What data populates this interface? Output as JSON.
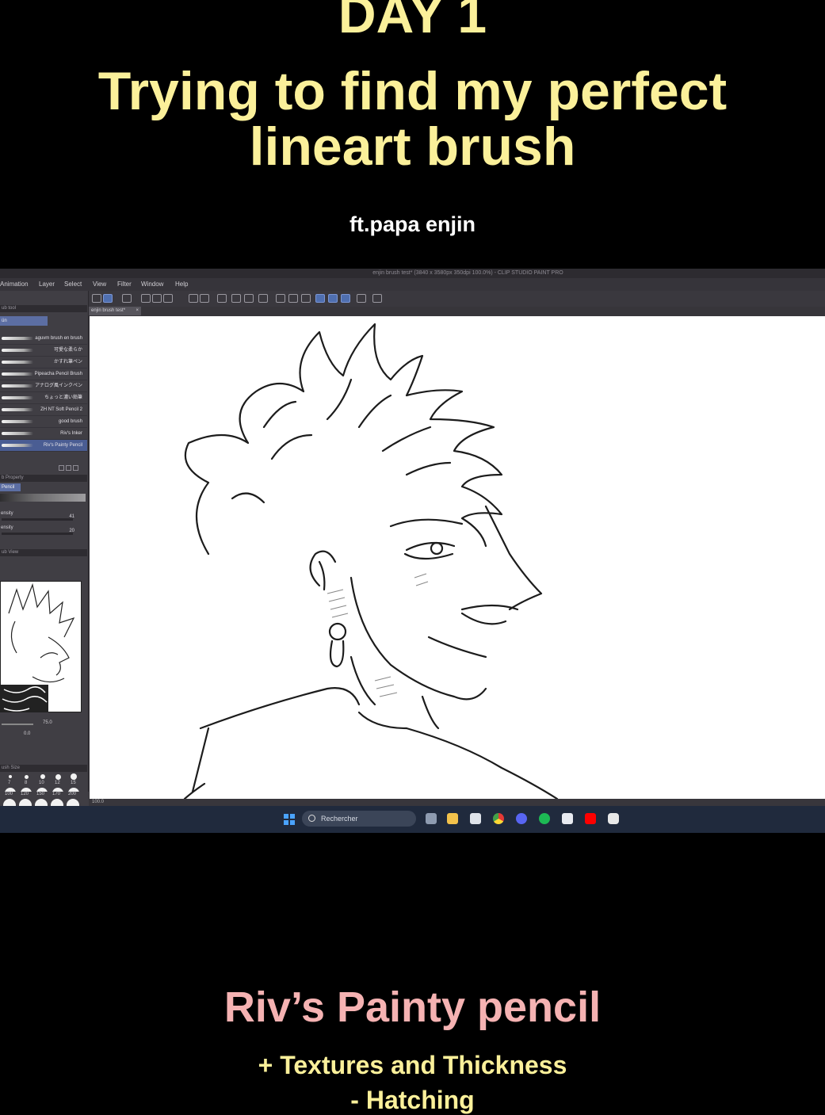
{
  "caption": {
    "day": "DAY 1",
    "headline_line1": "Trying to find my perfect",
    "headline_line2": "lineart brush",
    "featuring": "ft.papa enjin",
    "brush_name": "Riv’s Painty pencil",
    "feature_1": "+ Textures and Thickness",
    "feature_2": "- Hatching"
  },
  "app": {
    "window_title": "enjin brush test* (3840 x 3580px 350dpi 100.0%) - CLIP STUDIO PAINT PRO",
    "menu": [
      "Animation",
      "Layer",
      "Select",
      "View",
      "Filter",
      "Window",
      "Help"
    ],
    "doc_tab": "enjin brush test*",
    "doc_tab_close": "×",
    "subtool_header": "ub tool",
    "subtool_tab": "ün",
    "brushes": [
      "aguvm brush en brush",
      "可愛な柔らか",
      "かすれ筆ペン",
      "Pipeacha Pencil Brush",
      "アナログ風インクペン",
      "ちょっと濃い鉛筆",
      "ZH NT Soft Pencil 2",
      "good brush",
      "Riv's Inker",
      "Riv's Painty Pencil"
    ],
    "selected_brush_index": 9,
    "tool_property_header": "b Property",
    "tool_property_tab": "Pencil",
    "props": [
      {
        "name": "ensity",
        "value": "41"
      },
      {
        "name": "ensity",
        "value": "20"
      }
    ],
    "navigator_header": "ub View",
    "zoom_value": "75.0",
    "rotate_value": "0.0",
    "brush_size_header": "ush Size",
    "brush_sizes_row1": [
      "7",
      "8",
      "10",
      "12",
      "15"
    ],
    "brush_sizes_row2": [
      "25",
      "30",
      "40",
      "50",
      "60"
    ],
    "brush_sizes_row3": [
      "100",
      "120",
      "150",
      "170",
      "200"
    ],
    "status_zoom": "100.0"
  },
  "taskbar": {
    "search_placeholder": "Rechercher",
    "apps": [
      "file-explorer",
      "store",
      "chrome",
      "discord",
      "spotify",
      "paint",
      "youtube",
      "clip-studio"
    ]
  },
  "colors": {
    "caption_yellow": "#fbf09a",
    "caption_pink": "#f5b2b2",
    "selection_blue": "#4a5d93"
  }
}
